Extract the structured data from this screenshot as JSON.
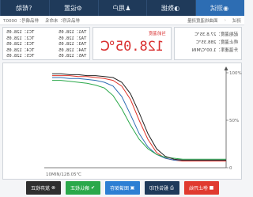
{
  "nav": {
    "items": [
      {
        "label": "帮助",
        "icon": "help-icon",
        "glyph": "?"
      },
      {
        "label": "设置",
        "icon": "gear-icon",
        "glyph": "⚙"
      },
      {
        "label": "用户",
        "icon": "user-icon",
        "glyph": "♟"
      },
      {
        "label": "数据",
        "icon": "data-icon",
        "glyph": "◐"
      },
      {
        "label": "测试",
        "icon": "test-icon",
        "glyph": "◉"
      }
    ],
    "active_index": 4
  },
  "breadcrumb": {
    "path": [
      "测试",
      "面曲线温度测量"
    ],
    "sample_label": "样品名称：",
    "sample_value": "样品名称：未命名",
    "sample_id": "样品编号：00007"
  },
  "params": {
    "lines": [
      "起始温度：27.8.35℃",
      "终止温度：288.35℃",
      "升温速率：1.00℃/MIN"
    ]
  },
  "current_temp": {
    "label": "当前温度",
    "value": "128.05℃"
  },
  "channels": [
    {
      "left": "TC1：128.05",
      "right": "TA1：128.05"
    },
    {
      "left": "TC2：128.05",
      "right": "TA2：128.05"
    },
    {
      "left": "TC3：128.05",
      "right": "TA3：128.05"
    },
    {
      "left": "TC4：128.05",
      "right": "TA4：128.05"
    },
    {
      "left": "TC5：128.05",
      "right": "TA5：128.05"
    }
  ],
  "chart_data": {
    "type": "line",
    "x_label": "10MIN/128.05℃",
    "x_start_label": "0",
    "y_labels": {
      "top": "100%",
      "mid": "50%",
      "bottom": "0"
    },
    "ylim": [
      0,
      100
    ],
    "x": [
      0,
      5,
      10,
      15,
      20,
      25,
      30,
      35,
      40,
      45,
      50,
      55,
      60,
      65,
      70,
      75,
      80,
      85,
      90,
      95,
      100
    ],
    "series": [
      {
        "color": "#e0352b",
        "values": [
          97,
          97,
          97,
          96,
          96,
          95,
          94,
          92,
          86,
          72,
          50,
          30,
          16,
          10,
          8,
          7,
          7,
          7,
          7,
          7,
          7
        ]
      },
      {
        "color": "#2d6db3",
        "values": [
          95,
          95,
          94,
          94,
          93,
          92,
          90,
          86,
          75,
          56,
          36,
          22,
          14,
          10,
          8,
          8,
          8,
          8,
          8,
          8,
          8
        ]
      },
      {
        "color": "#2aa84a",
        "values": [
          92,
          92,
          91,
          90,
          89,
          87,
          84,
          76,
          62,
          45,
          30,
          20,
          14,
          11,
          10,
          9,
          9,
          9,
          9,
          9,
          9
        ]
      },
      {
        "color": "#222222",
        "values": [
          99,
          99,
          98,
          98,
          97,
          97,
          96,
          95,
          90,
          78,
          58,
          36,
          20,
          12,
          9,
          8,
          8,
          8,
          8,
          8,
          8
        ]
      }
    ]
  },
  "actions": [
    {
      "label": "放弃校正",
      "icon": "x-icon",
      "glyph": "⊗",
      "style": "dark"
    },
    {
      "label": "确认校正",
      "icon": "check-icon",
      "glyph": "✔",
      "style": "green"
    },
    {
      "label": "图谱保存",
      "icon": "save-icon",
      "glyph": "▣",
      "style": "blue"
    },
    {
      "label": "报告打印",
      "icon": "print-icon",
      "glyph": "⎙",
      "style": "dblue"
    },
    {
      "label": "停止开始",
      "icon": "stop-icon",
      "glyph": "■",
      "style": "red"
    }
  ]
}
